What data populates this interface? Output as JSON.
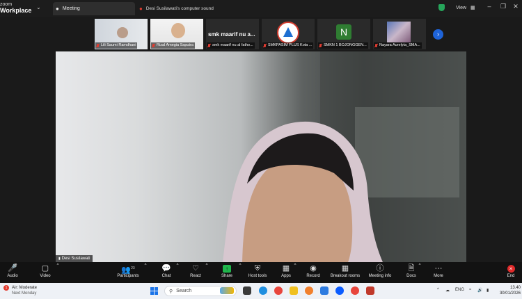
{
  "app": {
    "logo_line1": "zoom",
    "logo_line2": "Workplace",
    "tab_meeting": "Meeting",
    "tab_sound": "Desi Susilawati's computer sound",
    "view_label": "View"
  },
  "participants_strip": [
    {
      "name": "Lili Saumi Ramdhani",
      "type": "video"
    },
    {
      "name": "Rizal Amegia Saputra",
      "type": "video"
    },
    {
      "name": "smk maarif nu al fatho...",
      "type": "text",
      "display_text": "smk maarif nu a..."
    },
    {
      "name": "SMKPASIM PLUS Kota ...",
      "type": "logo"
    },
    {
      "name": "SMKN 1 BOJONGGEN...",
      "type": "letter",
      "letter": "N",
      "color": "#2f7d32"
    },
    {
      "name": "Nayara Aurelyta_SMA...",
      "type": "video"
    }
  ],
  "main_video": {
    "speaker_name": "Desi Susilawati"
  },
  "toolbar": {
    "audio": "Audio",
    "video": "Video",
    "participants": "Participants",
    "participants_count": "23",
    "chat": "Chat",
    "react": "React",
    "share": "Share",
    "host_tools": "Host tools",
    "apps": "Apps",
    "record": "Record",
    "breakout_rooms": "Breakout rooms",
    "meeting_info": "Meeting info",
    "docs": "Docs",
    "more": "More",
    "end": "End"
  },
  "taskbar": {
    "weather_badge": "1",
    "weather_title": "Air: Moderate",
    "weather_sub": "Next Monday",
    "search_placeholder": "Search",
    "lang": "ENG",
    "time": "13.40",
    "date": "30/01/2026"
  },
  "colors": {
    "accent_blue": "#1e63d8",
    "share_green": "#20b64c",
    "end_red": "#e02a2a",
    "muted_red": "#e03c31"
  }
}
